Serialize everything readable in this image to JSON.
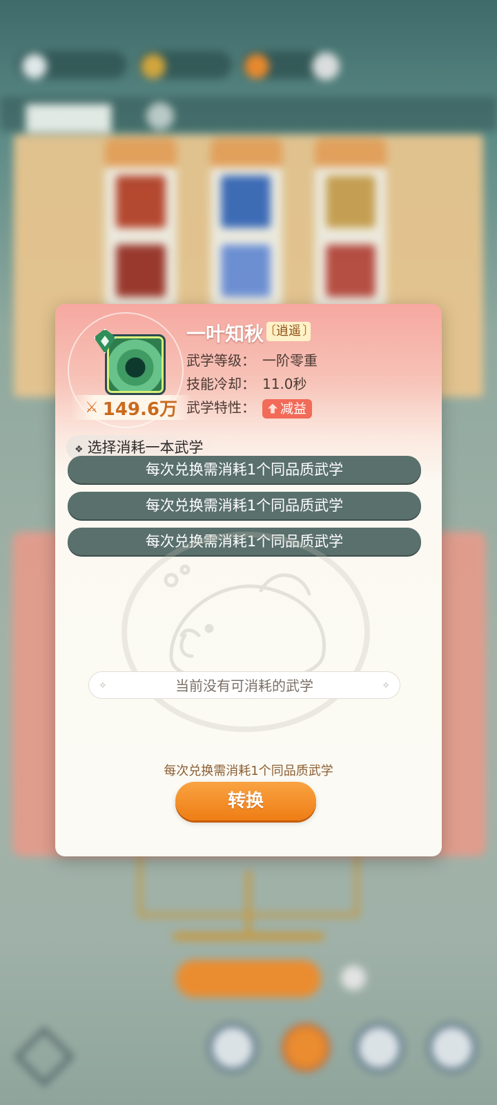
{
  "dialog": {
    "skill_name": "一叶知秋",
    "sect": "逍遥",
    "power": "149.6万",
    "attributes": [
      {
        "label": "武学等级：",
        "value": "一阶零重"
      },
      {
        "label": "技能冷却：",
        "value": "11.0秒"
      },
      {
        "label": "武学特性：",
        "value": "减益"
      }
    ],
    "select_label": "选择消耗一本武学",
    "options": [
      "每次兑换需消耗1个同品质武学",
      "每次兑换需消耗1个同品质武学",
      "每次兑换需消耗1个同品质武学"
    ],
    "empty_text": "当前没有可消耗的武学",
    "cost_hint": "每次兑换需消耗1个同品质武学",
    "convert_label": "转换"
  },
  "colors": {
    "option_bg": "#5a706d",
    "convert_btn": "#ef7d14",
    "trait_tag": "#f26a58",
    "dialog_header": "#f6a8a0"
  },
  "icons": {
    "skill": "green-ring-skill-icon",
    "quality": "green-diamond-gem-icon",
    "power": "crossed-swords-icon",
    "trait": "debuff-arrow-icon"
  }
}
